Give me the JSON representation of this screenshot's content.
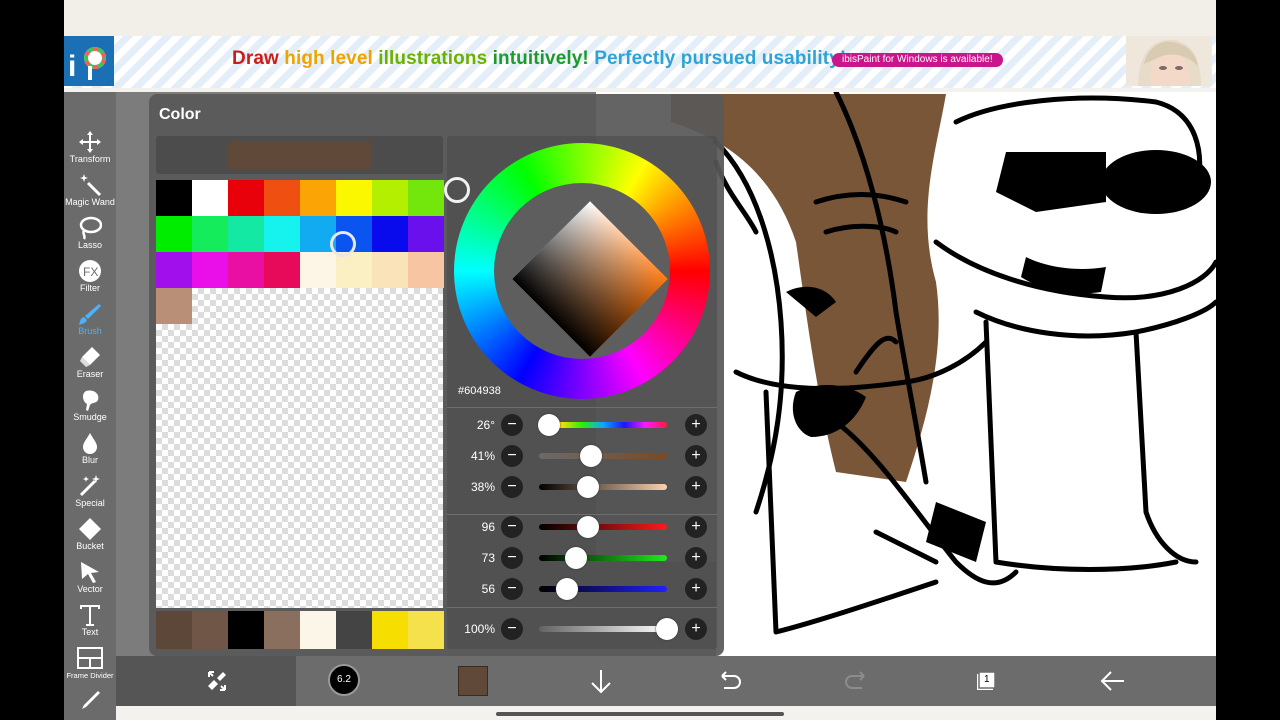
{
  "ad": {
    "headline_parts": [
      {
        "text": "Draw ",
        "color": "#cc1b1b"
      },
      {
        "text": "high level ",
        "color": "#f0a300"
      },
      {
        "text": "illustrations ",
        "color": "#69b200"
      },
      {
        "text": "intuitively! ",
        "color": "#1c9a2d"
      },
      {
        "text": "Perfectly pursued usability!",
        "color": "#2ea3d8"
      }
    ],
    "badge": "ibisPaint for Windows is available!"
  },
  "tools": [
    {
      "label": "Transform",
      "icon": "transform-icon"
    },
    {
      "label": "Magic Wand",
      "icon": "magic-wand-icon"
    },
    {
      "label": "Lasso",
      "icon": "lasso-icon"
    },
    {
      "label": "Filter",
      "icon": "filter-icon"
    },
    {
      "label": "Brush",
      "icon": "brush-icon",
      "active": true
    },
    {
      "label": "Eraser",
      "icon": "eraser-icon"
    },
    {
      "label": "Smudge",
      "icon": "smudge-icon"
    },
    {
      "label": "Blur",
      "icon": "blur-icon"
    },
    {
      "label": "Special",
      "icon": "special-icon"
    },
    {
      "label": "Bucket",
      "icon": "bucket-icon"
    },
    {
      "label": "Vector",
      "icon": "vector-icon"
    },
    {
      "label": "Text",
      "icon": "text-icon"
    },
    {
      "label": "Frame Divider",
      "icon": "frame-divider-icon"
    }
  ],
  "color_panel": {
    "title": "Color",
    "current_color": "#604938",
    "hex": "#604938",
    "palette": [
      "#000000",
      "#ffffff",
      "#e8000b",
      "#f04f12",
      "#faa505",
      "#fbf700",
      "#b4ef00",
      "#73e70c",
      "#00ed00",
      "#14ec5c",
      "#14e9a3",
      "#16f2ed",
      "#12aaf0",
      "#0a55f0",
      "#0a0bec",
      "#6a10ec",
      "#a20fed",
      "#ea0fe8",
      "#ea0fa3",
      "#e80a5a",
      "#fdf6e7",
      "#fbf0c3",
      "#fae3b8",
      "#f7c5a2",
      "#b98f77"
    ],
    "history": [
      "#5d4738",
      "#6f5647",
      "#000000",
      "#8a6f5f",
      "#fcf6e8",
      "#444444",
      "#f6de00",
      "#f4e14c"
    ],
    "sliders": [
      {
        "value": "26°",
        "knob": 0.08,
        "gradient": "linear-gradient(to right, #ff3b3b, #ffe100, #2df000, #0da7ff, #1a16ff, #ff18ff, #ff1a3a)"
      },
      {
        "value": "41%",
        "knob": 0.41,
        "gradient": "linear-gradient(to right, #6a6a6a, #7a4a22)"
      },
      {
        "value": "38%",
        "knob": 0.38,
        "gradient": "linear-gradient(to right, #000000, #fbd2b0)"
      },
      {
        "value": "96",
        "knob": 0.38,
        "gradient": "linear-gradient(to right, #000000, #ff1a1a)"
      },
      {
        "value": "73",
        "knob": 0.29,
        "gradient": "linear-gradient(to right, #000000, #1fea1f)"
      },
      {
        "value": "56",
        "knob": 0.22,
        "gradient": "linear-gradient(to right, #000000, #2020ff)"
      },
      {
        "value": "100%",
        "knob": 1.0,
        "gradient": "linear-gradient(to right, rgba(255,255,255,0.1), #ffffff)"
      }
    ]
  },
  "bottombar": {
    "brush_size": "6.2",
    "layer_count": "1"
  }
}
